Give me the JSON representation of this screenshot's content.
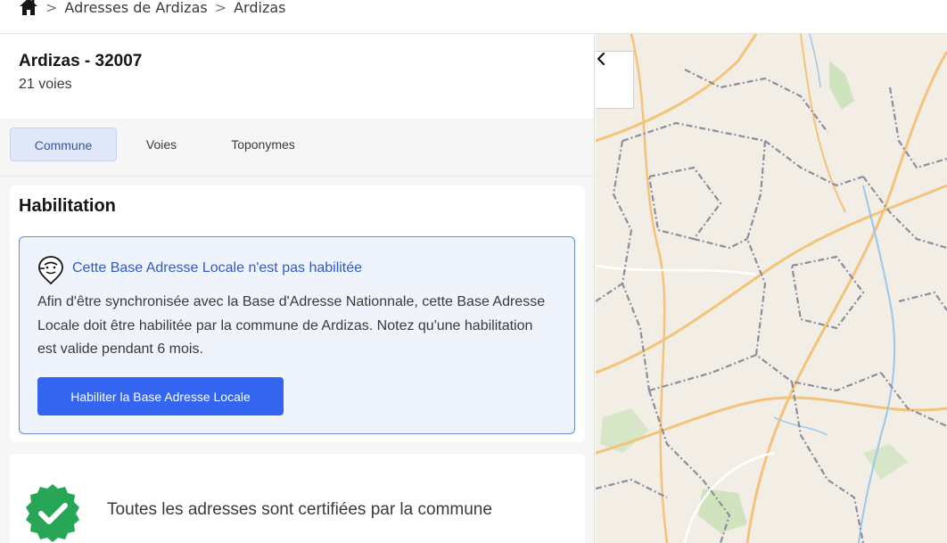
{
  "breadcrumb": {
    "home_icon": "home-icon",
    "separator": ">",
    "items": [
      "Adresses de Ardizas",
      "Ardizas"
    ]
  },
  "commune": {
    "title": "Ardizas - 32007",
    "subtitle": "21 voies"
  },
  "tabs": [
    {
      "label": "Commune",
      "active": true
    },
    {
      "label": "Voies",
      "active": false
    },
    {
      "label": "Toponymes",
      "active": false
    }
  ],
  "habilitation": {
    "title": "Habilitation",
    "notice_icon": "map-pin-face-icon",
    "notice_title": "Cette Base Adresse Locale n'est pas habilitée",
    "notice_text": "Afin d'être synchronisée avec la Base d'Adresse Nationnale, cette Base Adresse Locale doit être habilitée par la commune de Ardizas. Notez qu'une habilitation est valide pendant 6 mois.",
    "button_label": "Habiliter la Base Adresse Locale"
  },
  "certification": {
    "icon": "check-badge-icon",
    "text": "Toutes les adresses sont certifiées par la commune"
  },
  "map": {
    "collapse_icon": "chevron-left-icon"
  },
  "colors": {
    "primary": "#3465f1",
    "notice_border": "#6a8ad0",
    "notice_bg": "#eef3fc",
    "badge_green": "#27a658"
  }
}
